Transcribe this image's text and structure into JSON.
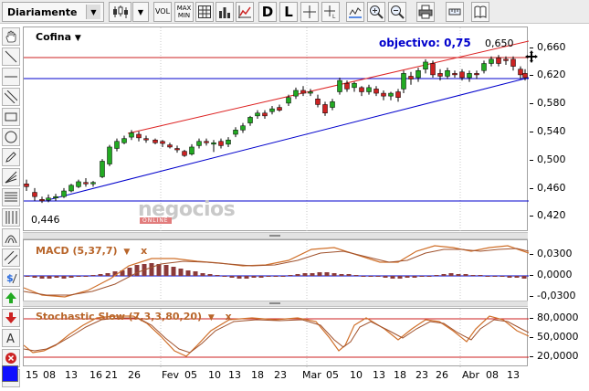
{
  "toolbar": {
    "period": "Diariamente",
    "vol_label": "VOL",
    "minmax_label": "MAX MIN",
    "d_label": "D",
    "l_label": "L"
  },
  "price_chart": {
    "symbol": "Cofina",
    "objective_label": "objectivo: 0,75",
    "high_marker": "0,650",
    "low_marker": "0,446",
    "y_ticks": [
      "0,660",
      "0,620",
      "0,580",
      "0,540",
      "0,500",
      "0,460",
      "0,420"
    ],
    "watermark": "negocios",
    "watermark_sub": "ONLINE"
  },
  "macd": {
    "title": "MACD (5,37,7)",
    "y_ticks": [
      "0,0300",
      "0,0000",
      "-0,0300"
    ]
  },
  "stochastic": {
    "title": "Stochastic Slow (7,3,3,80,20)",
    "y_ticks": [
      "80,0000",
      "50,0000",
      "20,0000"
    ]
  },
  "x_axis": {
    "labels": [
      "15",
      "08",
      "13",
      "16",
      "21",
      "26",
      "Fev",
      "05",
      "10",
      "13",
      "18",
      "23",
      "Mar",
      "05",
      "10",
      "13",
      "18",
      "23",
      "26",
      "Abr",
      "08",
      "13"
    ]
  },
  "colors": {
    "up_candle": "#22aa22",
    "down_candle": "#cc2222",
    "support_line": "#0000cc",
    "resistance_line": "#dd2222",
    "indicator_orange": "#d0702a",
    "histogram": "#8b3a3a"
  }
}
